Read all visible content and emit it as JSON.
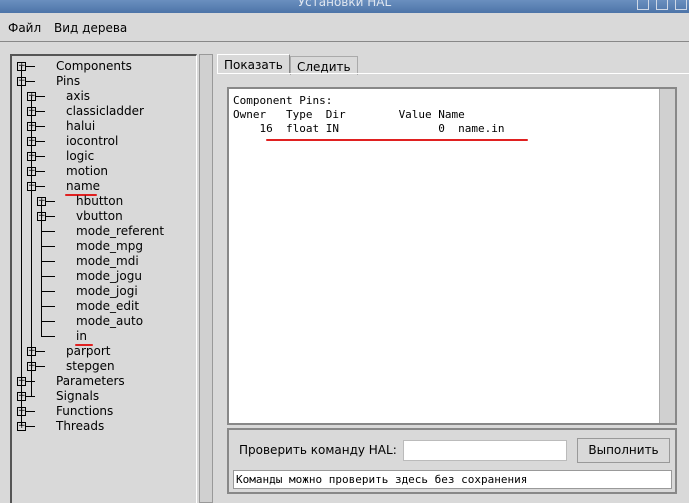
{
  "window": {
    "title": "Установки HAL"
  },
  "menu": [
    "Файл",
    "Вид дерева"
  ],
  "tree": [
    {
      "label": "Components",
      "level": 0,
      "expander": "plus"
    },
    {
      "label": "Pins",
      "level": 0,
      "expander": "minus"
    },
    {
      "label": "axis",
      "level": 1,
      "expander": "plus"
    },
    {
      "label": "classicladder",
      "level": 1,
      "expander": "plus"
    },
    {
      "label": "halui",
      "level": 1,
      "expander": "plus"
    },
    {
      "label": "iocontrol",
      "level": 1,
      "expander": "plus"
    },
    {
      "label": "logic",
      "level": 1,
      "expander": "plus"
    },
    {
      "label": "motion",
      "level": 1,
      "expander": "plus"
    },
    {
      "label": "name",
      "level": 1,
      "expander": "minus",
      "underlined": true
    },
    {
      "label": "hbutton",
      "level": 2,
      "expander": "plus"
    },
    {
      "label": "vbutton",
      "level": 2,
      "expander": "plus"
    },
    {
      "label": "mode_referent",
      "level": 2,
      "expander": "none"
    },
    {
      "label": "mode_mpg",
      "level": 2,
      "expander": "none"
    },
    {
      "label": "mode_mdi",
      "level": 2,
      "expander": "none"
    },
    {
      "label": "mode_jogu",
      "level": 2,
      "expander": "none"
    },
    {
      "label": "mode_jogi",
      "level": 2,
      "expander": "none"
    },
    {
      "label": "mode_edit",
      "level": 2,
      "expander": "none"
    },
    {
      "label": "mode_auto",
      "level": 2,
      "expander": "none"
    },
    {
      "label": "in",
      "level": 2,
      "expander": "none",
      "underlined": true
    },
    {
      "label": "parport",
      "level": 1,
      "expander": "plus"
    },
    {
      "label": "stepgen",
      "level": 1,
      "expander": "plus"
    },
    {
      "label": "Parameters",
      "level": 0,
      "expander": "plus"
    },
    {
      "label": "Signals",
      "level": 0,
      "expander": "plus"
    },
    {
      "label": "Functions",
      "level": 0,
      "expander": "plus"
    },
    {
      "label": "Threads",
      "level": 0,
      "expander": "plus"
    }
  ],
  "tabs": [
    {
      "label": "Показать",
      "active": true
    },
    {
      "label": "Следить",
      "active": false
    }
  ],
  "output": {
    "heading": "Component Pins:",
    "columns": [
      "Owner",
      "Type",
      "Dir",
      "Value",
      "Name"
    ],
    "rows": [
      {
        "owner": "16",
        "type": "float",
        "dir": "IN",
        "value": "0",
        "name": "name.in"
      }
    ]
  },
  "command": {
    "label": "Проверить команду HAL:",
    "value": "",
    "run_label": "Выполнить",
    "status": "Команды можно проверить здесь без сохранения"
  },
  "annotation_color": "#e02020"
}
